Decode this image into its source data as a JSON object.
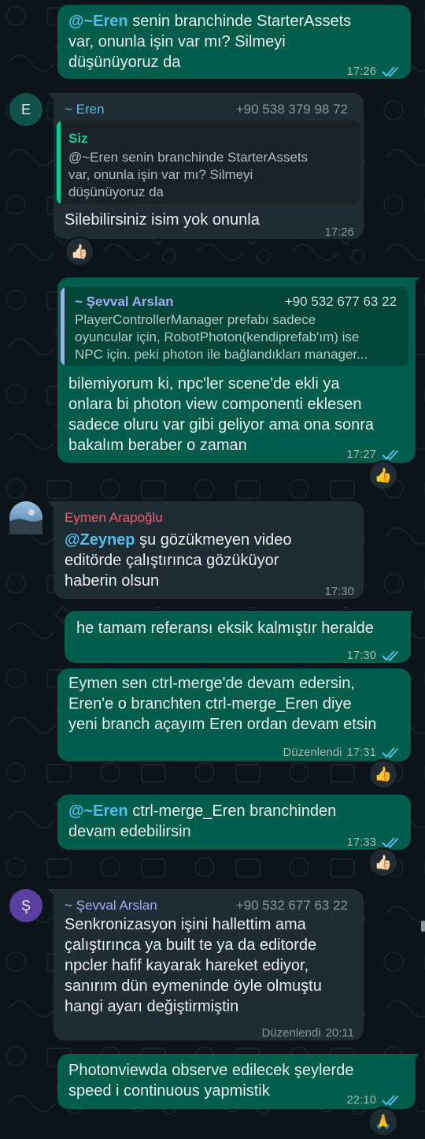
{
  "colors": {
    "background": "#0b141a",
    "outgoing_bubble": "#005c4b",
    "incoming_bubble": "#202c33",
    "tick_read": "#53bdeb",
    "mention_blue": "#53bdeb",
    "mention_green": "#25d366"
  },
  "messages": {
    "m1": {
      "mention": "@~Eren",
      "text_line1": " senin branchinde StarterAssets",
      "text_line2": "var, onunla işin var mı? Silmeyi",
      "text_line3": "düşünüyoruz da",
      "time": "17:26",
      "status_icon": "double-check-read-icon"
    },
    "m2": {
      "avatar_letter": "E",
      "sender": "~ Eren",
      "phone": "+90 538 379 98 72",
      "quote_author": "Siz",
      "quote_line1": "@~Eren senin branchinde StarterAssets",
      "quote_line2": "var, onunla işin var mı? Silmeyi",
      "quote_line3": "düşünüyoruz da",
      "text": "Silebilirsiniz isim yok onunla",
      "time": "17:26",
      "reaction": "👍🏻"
    },
    "m3": {
      "quote_author": "~ Şevval Arslan",
      "quote_phone": "+90 532 677 63 22",
      "quote_line1": "PlayerControllerManager prefabı sadece",
      "quote_line2": "oyuncular için, RobotPhoton(kendiprefab'ım) ise",
      "quote_line3": "NPC için. peki photon ile bağlandıkları manager...",
      "text_line1": "bilemiyorum ki, npc'ler scene'de ekli ya",
      "text_line2": "onlara bi photon view componenti eklesen",
      "text_line3": "sadece oluru var gibi geliyor ama ona sonra",
      "text_line4": "bakalım beraber o zaman",
      "time": "17:27",
      "reaction": "👍"
    },
    "m4": {
      "avatar_icon": "profile-photo-icon",
      "sender": "Eymen Arapoğlu",
      "mention": "@Zeynep",
      "text_line1": " şu gözükmeyen video",
      "text_line2": "editörde çalıştırınca gözüküyor",
      "text_line3": "haberin olsun",
      "time": "17:30"
    },
    "m5": {
      "text": "he tamam referansı eksik kalmıştır heralde",
      "time": "17:30"
    },
    "m6": {
      "text_line1": "Eymen sen ctrl-merge'de devam edersin,",
      "text_line2": "Eren'e o branchten ctrl-merge_Eren diye",
      "text_line3": "yeni branch açayım Eren ordan devam etsin",
      "edited": "Düzenlendi",
      "time": "17:31",
      "reaction": "👍"
    },
    "m7": {
      "mention": "@~Eren",
      "text_line1": " ctrl-merge_Eren branchinden",
      "text_line2": "devam edebilirsin",
      "time": "17:33",
      "reaction": "👍🏻"
    },
    "m8": {
      "avatar_letter": "Ş",
      "sender": "~ Şevval Arslan",
      "phone": "+90 532 677 63 22",
      "text_line1": "Senkronizasyon işini hallettim ama",
      "text_line2": "çalıştırınca ya built te ya da editorde",
      "text_line3": "npcler hafif kayarak hareket ediyor,",
      "text_line4": "sanırım dün eymeninde öyle olmuştu",
      "text_line5": "hangi ayarı değiştirmiştin",
      "edited": "Düzenlendi",
      "time": "20:11"
    },
    "m9": {
      "text_line1": "Photonviewda observe edilecek şeylerde",
      "text_line2": "speed i continuous yapmistik",
      "time": "22:10",
      "reaction": "🙏"
    }
  }
}
